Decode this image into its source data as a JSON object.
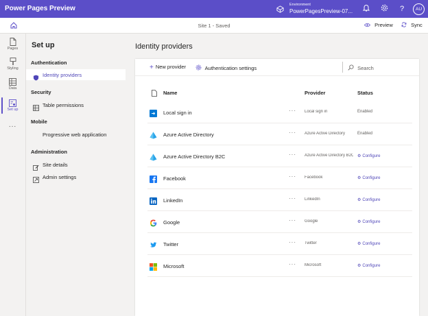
{
  "app": {
    "title": "Power Pages Preview"
  },
  "environment": {
    "label": "Environment",
    "name": "PowerPagesPreview-07..."
  },
  "user": {
    "initials": "AU"
  },
  "commandbar": {
    "site_status": "Site 1 - Saved",
    "preview_label": "Preview",
    "sync_label": "Sync"
  },
  "rail": {
    "items": [
      {
        "label": "Pages",
        "icon": "page-icon"
      },
      {
        "label": "Styling",
        "icon": "paintbrush-icon"
      },
      {
        "label": "Data",
        "icon": "table-icon"
      },
      {
        "label": "Set up",
        "icon": "setup-icon",
        "active": true
      }
    ],
    "more": "..."
  },
  "sidepanel": {
    "title": "Set up",
    "sections": [
      {
        "heading": "Authentication",
        "items": [
          {
            "label": "Identity providers",
            "icon": "shield-icon",
            "selected": true
          }
        ]
      },
      {
        "heading": "Security",
        "items": [
          {
            "label": "Table permissions",
            "icon": "table-icon"
          }
        ]
      },
      {
        "heading": "Mobile",
        "items": [
          {
            "label": "Progressive web application",
            "icon": ""
          }
        ]
      },
      {
        "heading": "Administration",
        "items": [
          {
            "label": "Site details",
            "icon": "edit-icon"
          },
          {
            "label": "Admin settings",
            "icon": "link-icon"
          }
        ]
      }
    ]
  },
  "main": {
    "title": "Identity providers",
    "toolbar": {
      "new_provider": "New provider",
      "auth_settings": "Authentication settings",
      "search_placeholder": "Search"
    },
    "table": {
      "headers": {
        "name": "Name",
        "provider": "Provider",
        "status": "Status"
      },
      "more": "···",
      "rows": [
        {
          "name": "Local sign in",
          "provider": "Local sign in",
          "status": "Enabled",
          "icon": "local-signin-icon"
        },
        {
          "name": "Azure Active Directory",
          "provider": "Azure Active Directory",
          "status": "Enabled",
          "icon": "azure-ad-icon"
        },
        {
          "name": "Azure Active Directory B2C",
          "provider": "Azure Active Directory B2C",
          "status": "Configure",
          "icon": "azure-ad-b2c-icon"
        },
        {
          "name": "Facebook",
          "provider": "Facebook",
          "status": "Configure",
          "icon": "facebook-icon"
        },
        {
          "name": "LinkedIn",
          "provider": "LinkedIn",
          "status": "Configure",
          "icon": "linkedin-icon"
        },
        {
          "name": "Google",
          "provider": "Google",
          "status": "Configure",
          "icon": "google-icon"
        },
        {
          "name": "Twitter",
          "provider": "Twitter",
          "status": "Configure",
          "icon": "twitter-icon"
        },
        {
          "name": "Microsoft",
          "provider": "Microsoft",
          "status": "Configure",
          "icon": "microsoft-icon"
        }
      ]
    }
  },
  "colors": {
    "brand": "#5b4ec8",
    "link": "#4f46b8"
  }
}
